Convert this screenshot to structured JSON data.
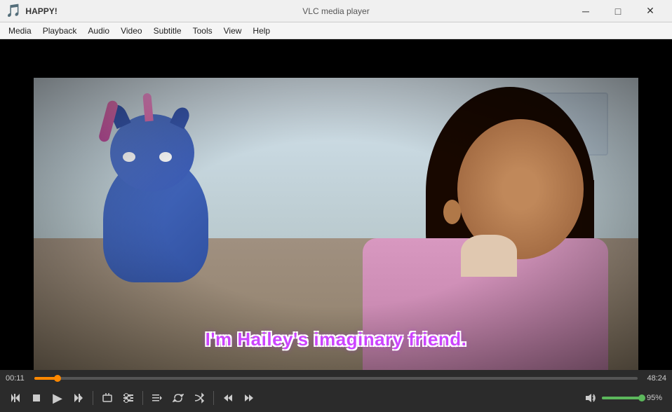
{
  "window": {
    "icon": "🎵",
    "app_name": "HAPPY!",
    "player_name": "VLC media player",
    "min_label": "─",
    "max_label": "□",
    "close_label": "✕"
  },
  "menubar": {
    "items": [
      "Media",
      "Playback",
      "Audio",
      "Video",
      "Subtitle",
      "Tools",
      "View",
      "Help"
    ]
  },
  "video": {
    "subtitle": "I'm Hailey's imaginary friend."
  },
  "controls": {
    "time_current": "00:11",
    "time_total": "48:24",
    "progress_pct": 3.8,
    "volume_pct": 95,
    "volume_label": "95%",
    "buttons": {
      "play": "▶",
      "prev_track": "⏮",
      "stop": "■",
      "next_track": "⏭",
      "frame_prev": "⊣",
      "slower": "slower",
      "faster": "faster",
      "fullscreen": "⛶",
      "extended": "≡",
      "playlist": "≡",
      "loop": "↺",
      "random": "⤮",
      "skip_back": "⏮",
      "skip_fwd": "⏭"
    }
  }
}
